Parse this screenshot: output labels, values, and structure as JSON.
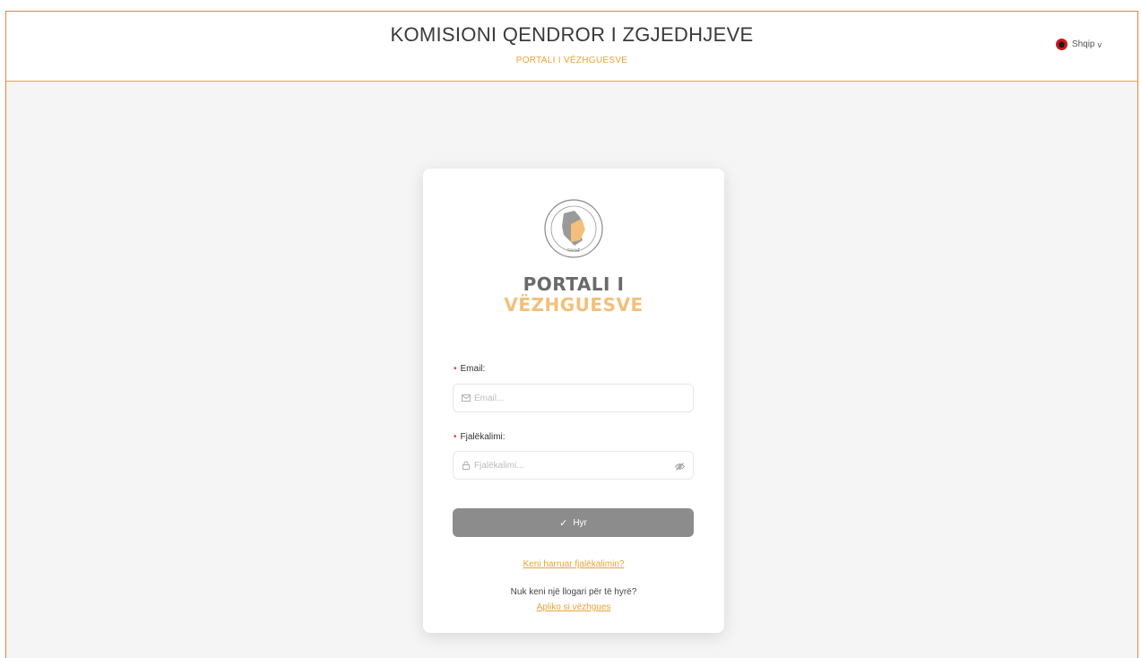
{
  "header": {
    "title": "KOMISIONI QENDROR I ZGJEDHJEVE",
    "subtitle": "PORTALI I VËZHGUESVE"
  },
  "language": {
    "label": "Shqip",
    "chevron": "v"
  },
  "card": {
    "seal_icon": "kqz-seal-icon",
    "title_line1": "PORTALI I",
    "title_line2": "VËZHGUESVE",
    "email": {
      "label": "Email:",
      "placeholder": "Email...",
      "value": ""
    },
    "password": {
      "label": "Fjalëkalimi:",
      "placeholder": "Fjalëkalimi...",
      "value": ""
    },
    "login_button": "Hyr",
    "forgot_link": "Keni harruar fjalëkalimin?",
    "no_account_text": "Nuk keni një llogari për të hyrë?",
    "apply_link": "Apliko si vëzhgues"
  },
  "colors": {
    "accent": "#e8a23a",
    "frame_border": "#e8823a",
    "button": "#8c8c8c",
    "required": "#e8402a"
  }
}
